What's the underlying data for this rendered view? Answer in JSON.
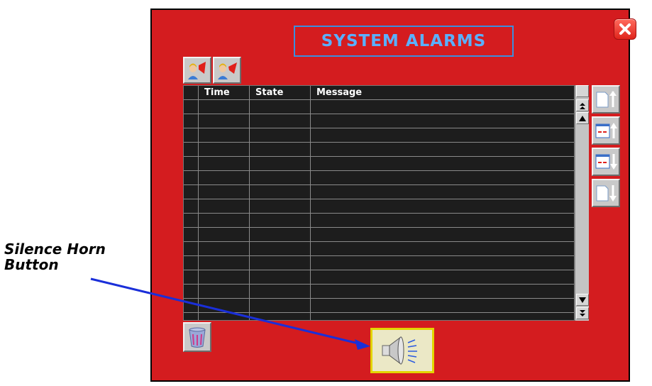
{
  "window": {
    "title": "SYSTEM ALARMS"
  },
  "annotation": {
    "label_line1": "Silence Horn",
    "label_line2": "Button"
  },
  "table": {
    "columns": [
      "",
      "Time",
      "State",
      "Message"
    ],
    "row_count": 16
  },
  "icons": {
    "close": "close-icon",
    "ack_one": "acknowledge-alarm-icon",
    "ack_all": "acknowledge-all-alarms-icon",
    "clear": "trash-can-icon",
    "page_top": "page-top-icon",
    "page_up": "page-up-icon",
    "page_down": "page-down-icon",
    "page_bottom": "page-bottom-icon",
    "silence": "speaker-horn-icon"
  },
  "colors": {
    "window_bg": "#d41c1f",
    "title_text": "#5ab0ff",
    "title_border": "#3a8fe0",
    "table_bg": "#1d1d1d",
    "silence_border": "#e2d500",
    "arrow": "#1a2fd9"
  }
}
